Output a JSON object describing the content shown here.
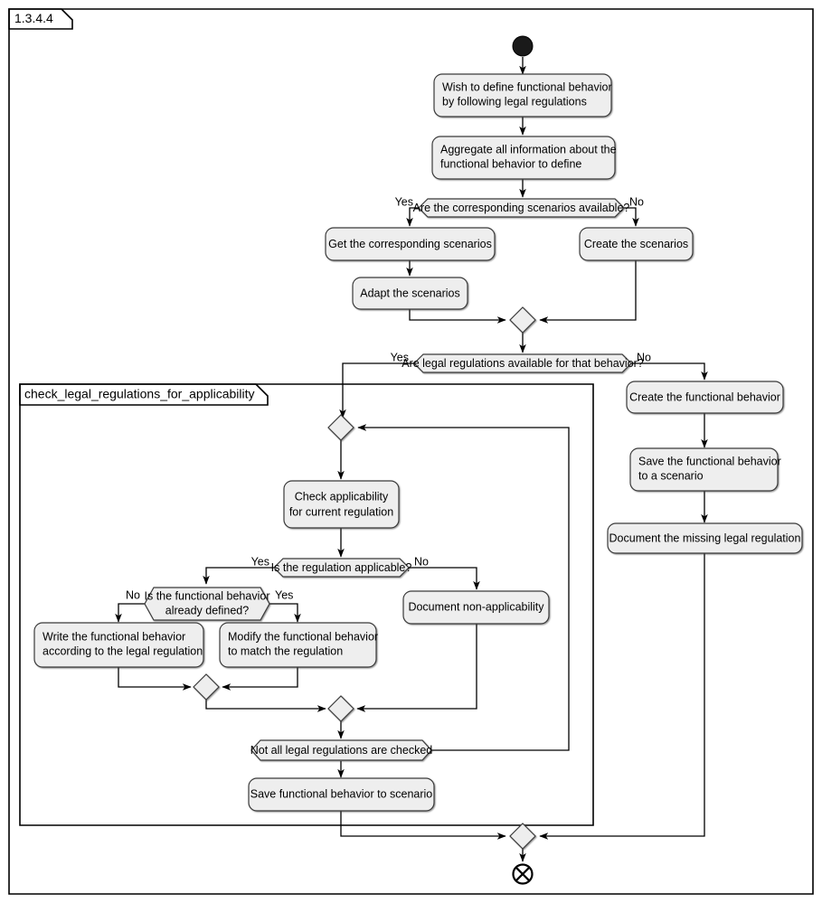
{
  "frame": {
    "label": "1.3.4.4",
    "partition_label": "check_legal_regulations_for_applicability"
  },
  "colors": {
    "node_fill": "#eeeeee",
    "node_stroke": "#3b3b3b",
    "edge": "#000000",
    "initial_node": "#1a1a1a",
    "background": "#ffffff"
  },
  "nodes": {
    "initial": "initial-node",
    "a1": "Wish to define functional behavior\nby following legal regulations",
    "a1_line1": "Wish to define functional behavior",
    "a1_line2": "by following legal regulations",
    "a2_line1": "Aggregate all information about the",
    "a2_line2": "functional behavior to define",
    "d1": "Are the corresponding scenarios available?",
    "a3": "Get the corresponding scenarios",
    "a4": "Create the scenarios",
    "a5": "Adapt the scenarios",
    "d2": "Are legal regulations available for that behavior?",
    "a6": "Create the functional behavior",
    "a7_line1": "Save the functional behavior",
    "a7_line2": "to a scenario",
    "a8": "Document the missing legal regulation",
    "a9_line1": "Check applicability",
    "a9_line2": "for current regulation",
    "d3": "Is the regulation applicable?",
    "d4_line1": "Is the functional behavior",
    "d4_line2": "already defined?",
    "a10_line1": "Write the functional behavior",
    "a10_line2": "according to the legal regulation",
    "a11_line1": "Modify the functional behavior",
    "a11_line2": "to match the regulation",
    "a12": "Document non-applicability",
    "d5": "Not all legal regulations are checked",
    "a13": "Save functional behavior to scenario",
    "final": "flow-final-node"
  },
  "guards": {
    "d1_yes": "Yes",
    "d1_no": "No",
    "d2_yes": "Yes",
    "d2_no": "No",
    "d3_yes": "Yes",
    "d3_no": "No",
    "d4_no": "No",
    "d4_yes": "Yes"
  }
}
